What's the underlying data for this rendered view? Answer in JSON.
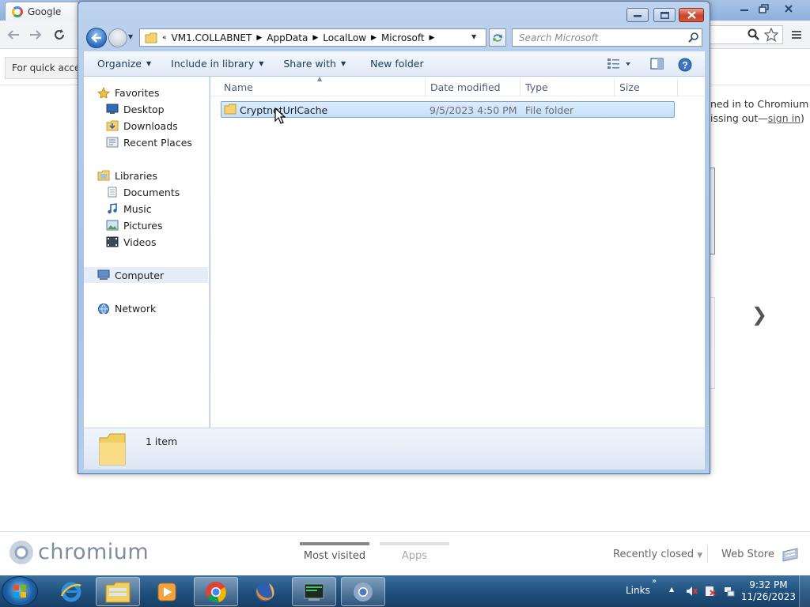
{
  "chrome": {
    "tab_title": "Google",
    "bookmark_hint": "For quick access",
    "signin_line1": "ned in to Chromium",
    "signin_line2_prefix": "issing out—",
    "signin_link": "sign in",
    "signin_line2_suffix": ")",
    "next_arrow": "❯",
    "brand": "chromium",
    "ntp_tabs": [
      "Most visited",
      "Apps"
    ],
    "recently_closed": "Recently closed",
    "web_store": "Web Store"
  },
  "explorer": {
    "breadcrumb": [
      "VM1.COLLABNET",
      "AppData",
      "LocalLow",
      "Microsoft"
    ],
    "search_placeholder": "Search Microsoft",
    "commands": [
      "Organize",
      "Include in library",
      "Share with",
      "New folder"
    ],
    "nav": {
      "favorites": "Favorites",
      "favorite_items": [
        "Desktop",
        "Downloads",
        "Recent Places"
      ],
      "libraries": "Libraries",
      "library_items": [
        "Documents",
        "Music",
        "Pictures",
        "Videos"
      ],
      "computer": "Computer",
      "network": "Network"
    },
    "columns": [
      "Name",
      "Date modified",
      "Type",
      "Size"
    ],
    "files": [
      {
        "name": "CryptnetUrlCache",
        "date": "9/5/2023 4:50 PM",
        "type": "File folder",
        "size": ""
      }
    ],
    "item_count": "1 item"
  },
  "taskbar": {
    "links_label": "Links",
    "time": "9:32 PM",
    "date": "11/26/2023"
  },
  "colors": {
    "selection": "#c4e0fb",
    "accent": "#1e395b",
    "taskbar": "#1f4f7c"
  }
}
